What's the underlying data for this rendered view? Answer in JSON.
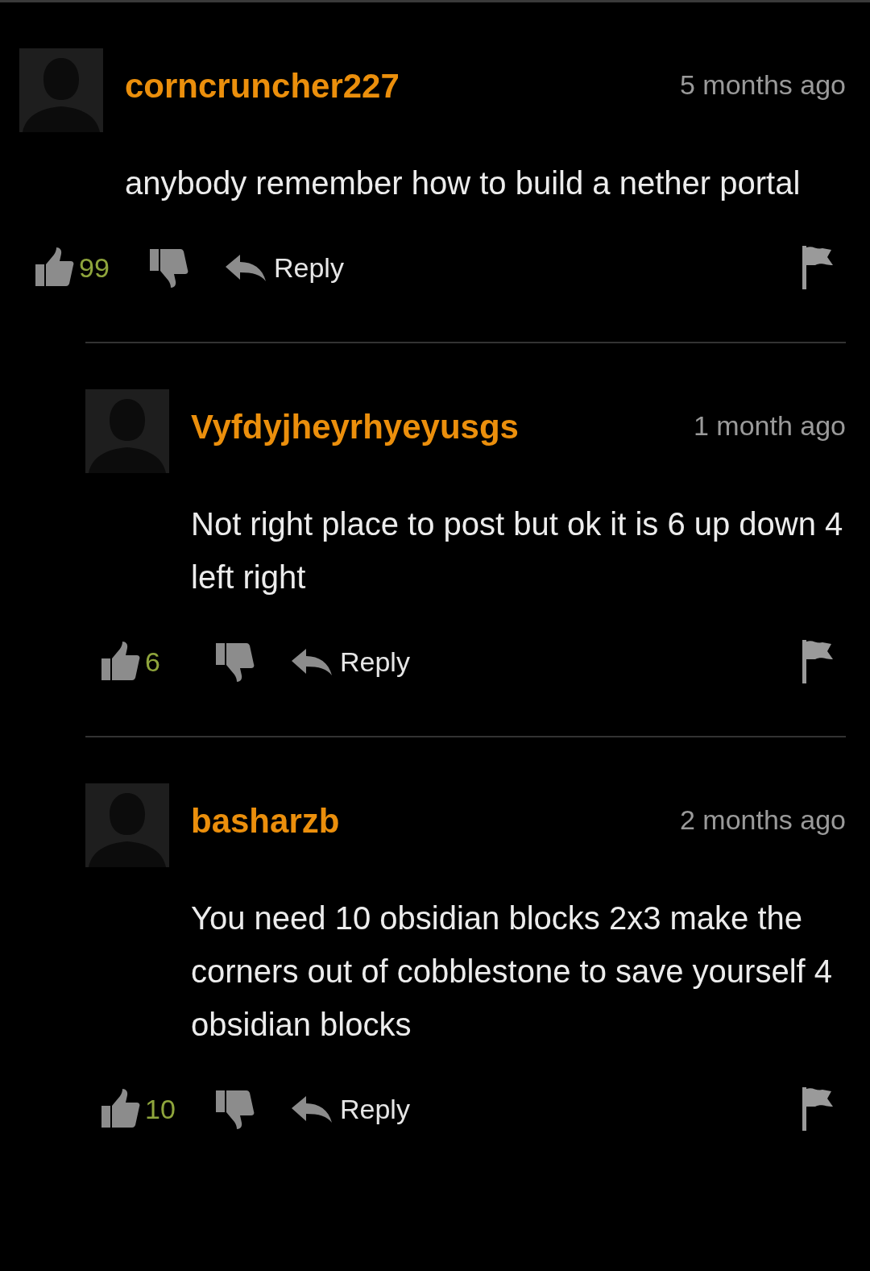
{
  "comments": [
    {
      "user": "corncruncher227",
      "time": "5 months ago",
      "text": "anybody remember how to build a nether portal",
      "likes": "99",
      "reply": "Reply",
      "children": [
        {
          "user": "Vyfdyjheyrhyeyusgs",
          "time": "1 month ago",
          "text": "Not right place to post but ok it is 6 up down 4 left right",
          "likes": "6",
          "reply": "Reply"
        },
        {
          "user": "basharzb",
          "time": "2 months ago",
          "text": "You need 10 obsidian blocks 2x3 make the corners out of cobblestone to save yourself 4 obsidian blocks",
          "likes": "10",
          "reply": "Reply"
        }
      ]
    }
  ]
}
